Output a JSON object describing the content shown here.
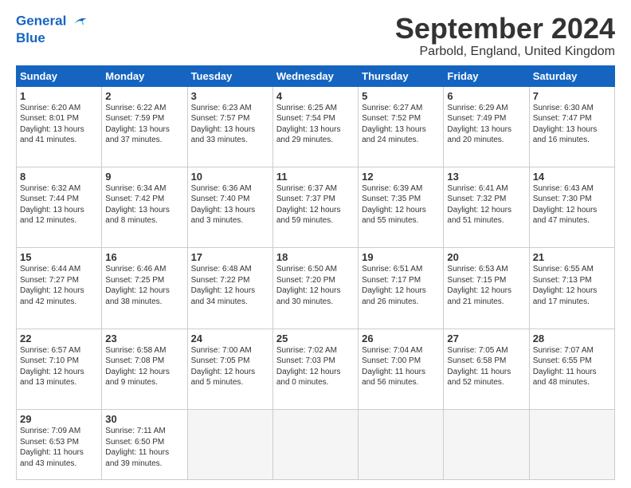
{
  "header": {
    "logo_line1": "General",
    "logo_line2": "Blue",
    "month": "September 2024",
    "location": "Parbold, England, United Kingdom"
  },
  "days": [
    "Sunday",
    "Monday",
    "Tuesday",
    "Wednesday",
    "Thursday",
    "Friday",
    "Saturday"
  ],
  "weeks": [
    [
      {
        "date": "1",
        "info": "Sunrise: 6:20 AM\nSunset: 8:01 PM\nDaylight: 13 hours\nand 41 minutes."
      },
      {
        "date": "2",
        "info": "Sunrise: 6:22 AM\nSunset: 7:59 PM\nDaylight: 13 hours\nand 37 minutes."
      },
      {
        "date": "3",
        "info": "Sunrise: 6:23 AM\nSunset: 7:57 PM\nDaylight: 13 hours\nand 33 minutes."
      },
      {
        "date": "4",
        "info": "Sunrise: 6:25 AM\nSunset: 7:54 PM\nDaylight: 13 hours\nand 29 minutes."
      },
      {
        "date": "5",
        "info": "Sunrise: 6:27 AM\nSunset: 7:52 PM\nDaylight: 13 hours\nand 24 minutes."
      },
      {
        "date": "6",
        "info": "Sunrise: 6:29 AM\nSunset: 7:49 PM\nDaylight: 13 hours\nand 20 minutes."
      },
      {
        "date": "7",
        "info": "Sunrise: 6:30 AM\nSunset: 7:47 PM\nDaylight: 13 hours\nand 16 minutes."
      }
    ],
    [
      {
        "date": "8",
        "info": "Sunrise: 6:32 AM\nSunset: 7:44 PM\nDaylight: 13 hours\nand 12 minutes."
      },
      {
        "date": "9",
        "info": "Sunrise: 6:34 AM\nSunset: 7:42 PM\nDaylight: 13 hours\nand 8 minutes."
      },
      {
        "date": "10",
        "info": "Sunrise: 6:36 AM\nSunset: 7:40 PM\nDaylight: 13 hours\nand 3 minutes."
      },
      {
        "date": "11",
        "info": "Sunrise: 6:37 AM\nSunset: 7:37 PM\nDaylight: 12 hours\nand 59 minutes."
      },
      {
        "date": "12",
        "info": "Sunrise: 6:39 AM\nSunset: 7:35 PM\nDaylight: 12 hours\nand 55 minutes."
      },
      {
        "date": "13",
        "info": "Sunrise: 6:41 AM\nSunset: 7:32 PM\nDaylight: 12 hours\nand 51 minutes."
      },
      {
        "date": "14",
        "info": "Sunrise: 6:43 AM\nSunset: 7:30 PM\nDaylight: 12 hours\nand 47 minutes."
      }
    ],
    [
      {
        "date": "15",
        "info": "Sunrise: 6:44 AM\nSunset: 7:27 PM\nDaylight: 12 hours\nand 42 minutes."
      },
      {
        "date": "16",
        "info": "Sunrise: 6:46 AM\nSunset: 7:25 PM\nDaylight: 12 hours\nand 38 minutes."
      },
      {
        "date": "17",
        "info": "Sunrise: 6:48 AM\nSunset: 7:22 PM\nDaylight: 12 hours\nand 34 minutes."
      },
      {
        "date": "18",
        "info": "Sunrise: 6:50 AM\nSunset: 7:20 PM\nDaylight: 12 hours\nand 30 minutes."
      },
      {
        "date": "19",
        "info": "Sunrise: 6:51 AM\nSunset: 7:17 PM\nDaylight: 12 hours\nand 26 minutes."
      },
      {
        "date": "20",
        "info": "Sunrise: 6:53 AM\nSunset: 7:15 PM\nDaylight: 12 hours\nand 21 minutes."
      },
      {
        "date": "21",
        "info": "Sunrise: 6:55 AM\nSunset: 7:13 PM\nDaylight: 12 hours\nand 17 minutes."
      }
    ],
    [
      {
        "date": "22",
        "info": "Sunrise: 6:57 AM\nSunset: 7:10 PM\nDaylight: 12 hours\nand 13 minutes."
      },
      {
        "date": "23",
        "info": "Sunrise: 6:58 AM\nSunset: 7:08 PM\nDaylight: 12 hours\nand 9 minutes."
      },
      {
        "date": "24",
        "info": "Sunrise: 7:00 AM\nSunset: 7:05 PM\nDaylight: 12 hours\nand 5 minutes."
      },
      {
        "date": "25",
        "info": "Sunrise: 7:02 AM\nSunset: 7:03 PM\nDaylight: 12 hours\nand 0 minutes."
      },
      {
        "date": "26",
        "info": "Sunrise: 7:04 AM\nSunset: 7:00 PM\nDaylight: 11 hours\nand 56 minutes."
      },
      {
        "date": "27",
        "info": "Sunrise: 7:05 AM\nSunset: 6:58 PM\nDaylight: 11 hours\nand 52 minutes."
      },
      {
        "date": "28",
        "info": "Sunrise: 7:07 AM\nSunset: 6:55 PM\nDaylight: 11 hours\nand 48 minutes."
      }
    ],
    [
      {
        "date": "29",
        "info": "Sunrise: 7:09 AM\nSunset: 6:53 PM\nDaylight: 11 hours\nand 43 minutes."
      },
      {
        "date": "30",
        "info": "Sunrise: 7:11 AM\nSunset: 6:50 PM\nDaylight: 11 hours\nand 39 minutes."
      },
      {
        "date": "",
        "info": ""
      },
      {
        "date": "",
        "info": ""
      },
      {
        "date": "",
        "info": ""
      },
      {
        "date": "",
        "info": ""
      },
      {
        "date": "",
        "info": ""
      }
    ]
  ]
}
